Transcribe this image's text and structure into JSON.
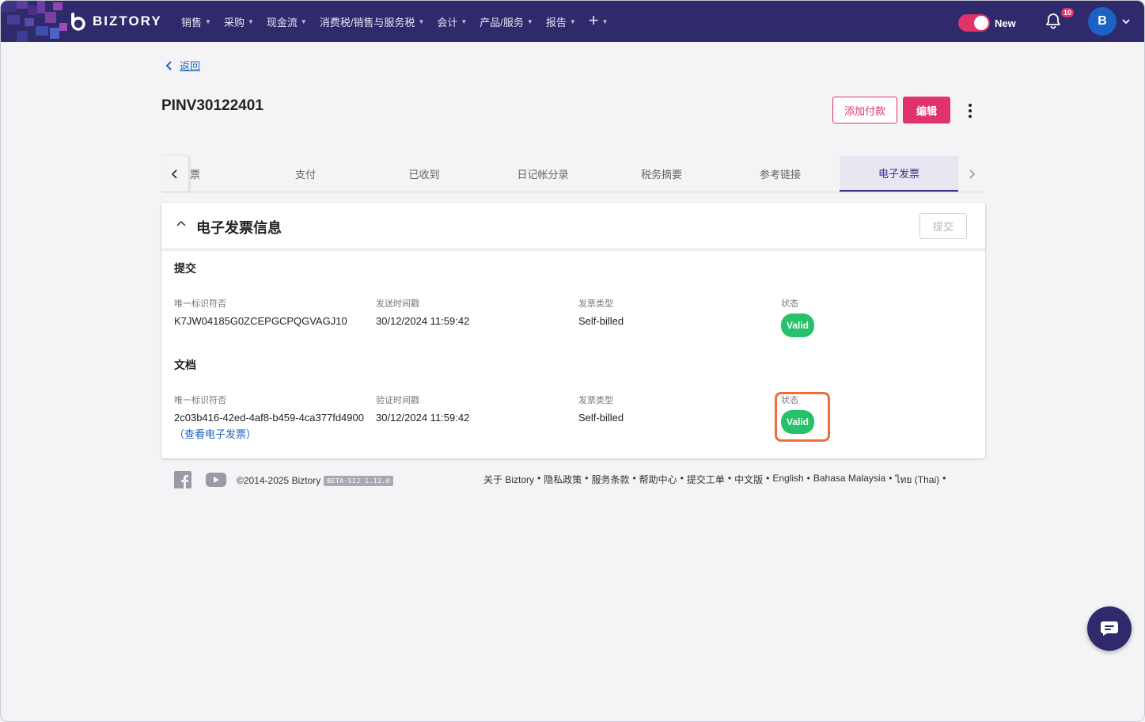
{
  "brand": {
    "name": "BIZTORY"
  },
  "nav": {
    "items": [
      {
        "label": "销售"
      },
      {
        "label": "采购"
      },
      {
        "label": "现金流"
      },
      {
        "label": "消费税/销售与服务税"
      },
      {
        "label": "会计"
      },
      {
        "label": "产品/服务"
      },
      {
        "label": "报告"
      }
    ],
    "add_icon": "plus-icon",
    "toggle_label": "New",
    "notification_count": "10",
    "avatar_initial": "B"
  },
  "page": {
    "back_label": "返回",
    "title": "PINV30122401",
    "add_payment_label": "添加付款",
    "edit_label": "编辑"
  },
  "tabs": {
    "partial_label": "票",
    "items": [
      {
        "label": "支付"
      },
      {
        "label": "已收到"
      },
      {
        "label": "日记帐分录"
      },
      {
        "label": "税务摘要"
      },
      {
        "label": "参考链接"
      },
      {
        "label": "电子发票"
      }
    ],
    "active_index": 5
  },
  "einvoice": {
    "title": "电子发票信息",
    "submit_label": "提交",
    "submission": {
      "heading": "提交",
      "uid_label": "唯一标识符否",
      "uid_value": "K7JW04185G0ZCEPGCPQGVAGJ10",
      "time_label": "发送时间戳",
      "time_value": "30/12/2024 11:59:42",
      "type_label": "发票类型",
      "type_value": "Self-billed",
      "status_label": "状态",
      "status_value": "Valid"
    },
    "document": {
      "heading": "文档",
      "uid_label": "唯一标识符否",
      "uid_value": "2c03b416-42ed-4af8-b459-4ca377fd4900",
      "view_link": "（查看电子发票）",
      "time_label": "验证时间戳",
      "time_value": "30/12/2024 11:59:42",
      "type_label": "发票类型",
      "type_value": "Self-billed",
      "status_label": "状态",
      "status_value": "Valid"
    },
    "status_color": "#27c06b"
  },
  "footer": {
    "copyright": "©2014-2025 Biztory",
    "version": "BETA-SIJ 1.13.0",
    "links": [
      "关于 Biztory",
      "隐私政策",
      "服务条款",
      "帮助中心",
      "提交工单",
      "中文版",
      "English",
      "Bahasa Malaysia",
      "ไทย (Thai)"
    ]
  },
  "colors": {
    "nav_bg": "#2e2a6b",
    "accent": "#e0336b",
    "link": "#1c62c4",
    "highlight": "#f06d3a"
  }
}
